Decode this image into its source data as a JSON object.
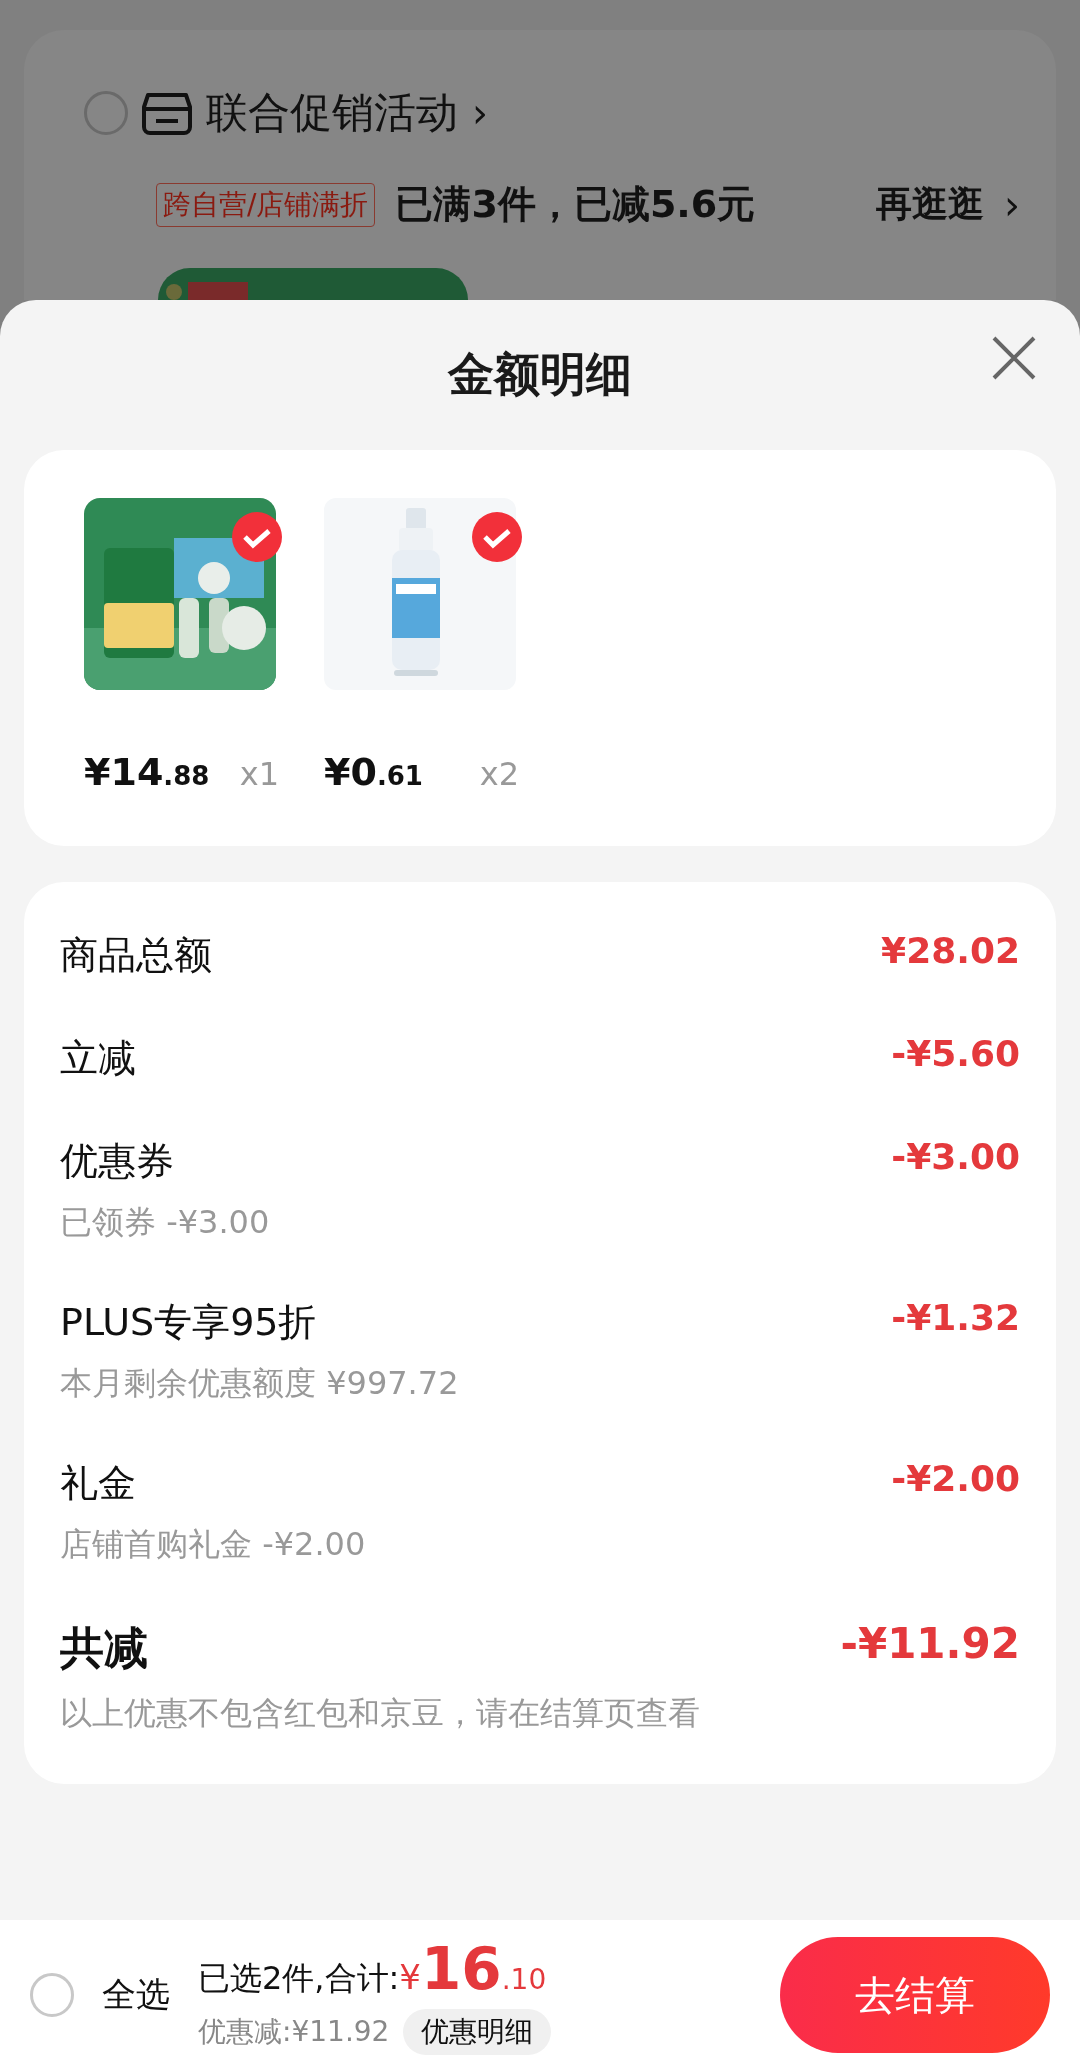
{
  "background": {
    "promo": {
      "checked": false,
      "title": "联合促销活动",
      "chevron": "›",
      "tag": "跨自营/店铺满折",
      "status": "已满3件，已减5.6元",
      "link": "再逛逛",
      "link_chevron": "›"
    }
  },
  "sheet": {
    "title": "金额明细",
    "products": [
      {
        "selected": true,
        "kind": "box",
        "price_int": "¥14",
        "price_dec": ".88",
        "quantity": "x1"
      },
      {
        "selected": true,
        "kind": "bottle",
        "price_int": "¥0",
        "price_dec": ".61",
        "quantity": "x2"
      }
    ],
    "details": [
      {
        "kind": "row",
        "label": "商品总额",
        "amount": "¥28.02"
      },
      {
        "kind": "row",
        "label": "立减",
        "amount": "-¥5.60"
      },
      {
        "kind": "row",
        "label": "优惠券",
        "note": "已领券 -¥3.00",
        "amount": "-¥3.00"
      },
      {
        "kind": "row",
        "label": "PLUS专享95折",
        "note": "本月剩余优惠额度 ¥997.72",
        "amount": "-¥1.32"
      },
      {
        "kind": "row",
        "label": "礼金",
        "note": "店铺首购礼金 -¥2.00",
        "amount": "-¥2.00"
      },
      {
        "kind": "total",
        "label": "共减",
        "note": "以上优惠不包含红包和京豆，请在结算页查看",
        "amount": "-¥11.92"
      }
    ]
  },
  "footer": {
    "select_all": {
      "checked": false,
      "label": "全选"
    },
    "summary": "已选2件,合计:",
    "currency": "¥",
    "total_int": "16",
    "total_dec": ".10",
    "discount": "优惠减:¥11.92",
    "details_button": "优惠明细",
    "checkout": "去结算"
  }
}
